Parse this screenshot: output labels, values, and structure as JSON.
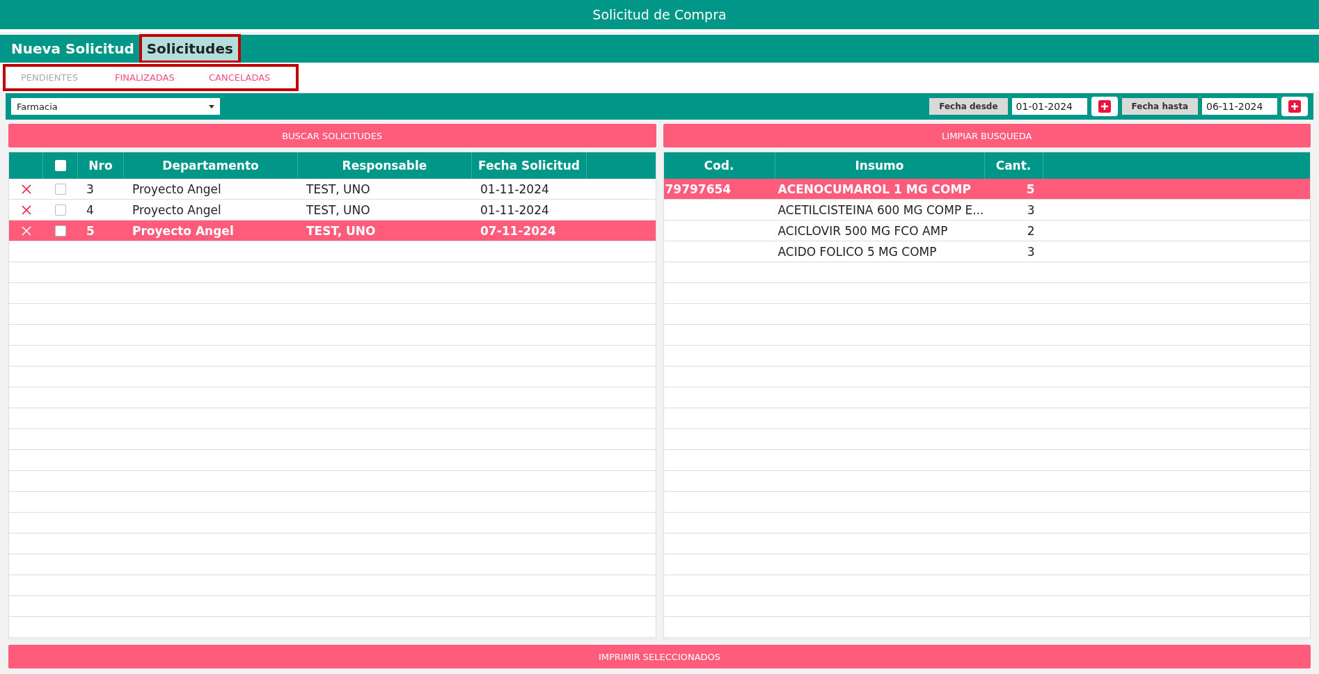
{
  "window": {
    "title": "Solicitud de Compra"
  },
  "tabs": [
    {
      "label": "Nueva Solicitud",
      "selected": false,
      "highlighted": false
    },
    {
      "label": "Solicitudes",
      "selected": true,
      "highlighted": true
    }
  ],
  "subtabs": {
    "highlighted": true,
    "items": [
      {
        "label": "PENDIENTES",
        "selected": true
      },
      {
        "label": "FINALIZADAS",
        "selected": false
      },
      {
        "label": "CANCELADAS",
        "selected": false
      }
    ]
  },
  "filters": {
    "department": "Farmacia",
    "date_from_label": "Fecha desde",
    "date_from": "01-01-2024",
    "date_to_label": "Fecha hasta",
    "date_to": "06-11-2024"
  },
  "search_button": "BUSCAR SOLICITUDES",
  "clear_button": "LIMPIAR BUSQUEDA",
  "requests": {
    "select_all_checked": false,
    "columns": [
      "Nro",
      "Departamento",
      "Responsable",
      "Fecha Solicitud"
    ],
    "rows": [
      {
        "nro": "3",
        "departamento": "Proyecto Angel",
        "responsable": "TEST, UNO",
        "fecha": "01-11-2024",
        "checked": false,
        "selected": false
      },
      {
        "nro": "4",
        "departamento": "Proyecto Angel",
        "responsable": "TEST, UNO",
        "fecha": "01-11-2024",
        "checked": false,
        "selected": false
      },
      {
        "nro": "5",
        "departamento": "Proyecto Angel",
        "responsable": "TEST, UNO",
        "fecha": "07-11-2024",
        "checked": false,
        "selected": true
      }
    ]
  },
  "items": {
    "columns": [
      "Cod.",
      "Insumo",
      "Cant."
    ],
    "rows": [
      {
        "cod": "79797654",
        "insumo": "ACENOCUMAROL 1 MG COMP",
        "cant": "5",
        "selected": true
      },
      {
        "insumo": "ACETILCISTEINA 600 MG COMP E...",
        "cant": "3",
        "selected": false
      },
      {
        "insumo": "ACICLOVIR 500 MG  FCO AMP",
        "cant": "2",
        "selected": false
      },
      {
        "insumo": "ACIDO FOLICO 5 MG COMP",
        "cant": "3",
        "selected": false
      }
    ]
  },
  "print_button": "IMPRIMIR SELECCIONADOS"
}
